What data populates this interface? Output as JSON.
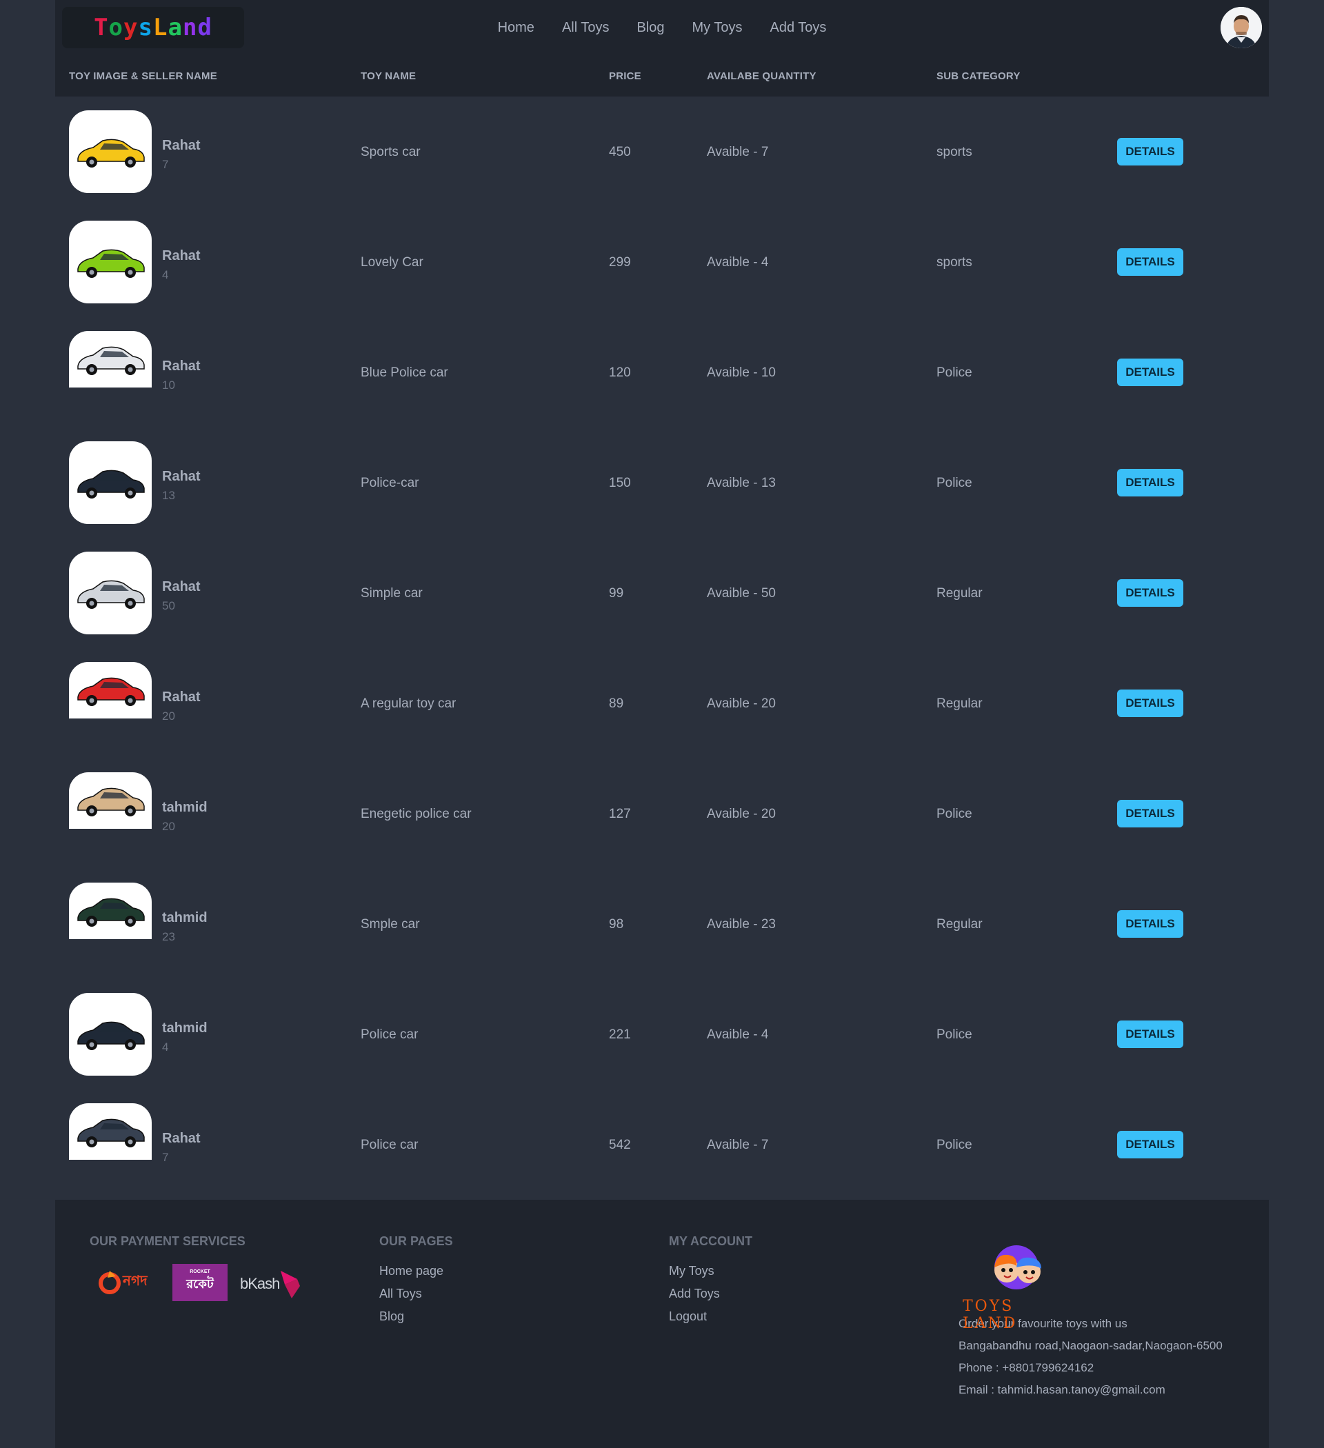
{
  "brand": {
    "letters": [
      {
        "ch": "T",
        "color": "#e11d48"
      },
      {
        "ch": "o",
        "color": "#16a34a"
      },
      {
        "ch": "y",
        "color": "#dc2626"
      },
      {
        "ch": "s",
        "color": "#0ea5e9"
      },
      {
        "ch": "L",
        "color": "#f59e0b"
      },
      {
        "ch": "a",
        "color": "#22c55e"
      },
      {
        "ch": "n",
        "color": "#9333ea"
      },
      {
        "ch": "d",
        "color": "#7c3aed"
      }
    ]
  },
  "nav": [
    "Home",
    "All Toys",
    "Blog",
    "My Toys",
    "Add Toys"
  ],
  "table": {
    "headers": [
      "Toy Image & Seller Name",
      "Toy Name",
      "Price",
      "Availabe Quantity",
      "Sub Category"
    ],
    "button_label": "DETAILS",
    "rows": [
      {
        "seller": "Rahat",
        "qty": "7",
        "name": "Sports car",
        "price": "450",
        "available": "Avaible - 7",
        "category": "sports",
        "car_color": "#f5c518",
        "short": false
      },
      {
        "seller": "Rahat",
        "qty": "4",
        "name": "Lovely Car",
        "price": "299",
        "available": "Avaible - 4",
        "category": "sports",
        "car_color": "#84cc16",
        "short": false
      },
      {
        "seller": "Rahat",
        "qty": "10",
        "name": "Blue Police car",
        "price": "120",
        "available": "Avaible - 10",
        "category": "Police",
        "car_color": "#e5e7eb",
        "short": true
      },
      {
        "seller": "Rahat",
        "qty": "13",
        "name": "Police-car",
        "price": "150",
        "available": "Avaible - 13",
        "category": "Police",
        "car_color": "#1f2937",
        "short": false
      },
      {
        "seller": "Rahat",
        "qty": "50",
        "name": "Simple car",
        "price": "99",
        "available": "Avaible - 50",
        "category": "Regular",
        "car_color": "#d1d5db",
        "short": false
      },
      {
        "seller": "Rahat",
        "qty": "20",
        "name": "A regular toy car",
        "price": "89",
        "available": "Avaible - 20",
        "category": "Regular",
        "car_color": "#dc2626",
        "short": true
      },
      {
        "seller": "tahmid",
        "qty": "20",
        "name": "Enegetic police car",
        "price": "127",
        "available": "Avaible - 20",
        "category": "Police",
        "car_color": "#d6b48a",
        "short": true
      },
      {
        "seller": "tahmid",
        "qty": "23",
        "name": "Smple car",
        "price": "98",
        "available": "Avaible - 23",
        "category": "Regular",
        "car_color": "#1f3b2f",
        "short": true
      },
      {
        "seller": "tahmid",
        "qty": "4",
        "name": "Police car",
        "price": "221",
        "available": "Avaible - 4",
        "category": "Police",
        "car_color": "#1f2937",
        "short": false
      },
      {
        "seller": "Rahat",
        "qty": "7",
        "name": "Police car",
        "price": "542",
        "available": "Avaible - 7",
        "category": "Police",
        "car_color": "#374151",
        "short": true
      }
    ]
  },
  "footer": {
    "payment_heading": "Our Payment Services",
    "payments": {
      "nagad": "নগদ",
      "rocket": "রকেট",
      "rocket_top": "ROCKET",
      "bkash": "bKash"
    },
    "pages_heading": "Our Pages",
    "pages": [
      "Home page",
      "All Toys",
      "Blog"
    ],
    "account_heading": "My Account",
    "account": [
      "My Toys",
      "Add Toys",
      "Logout"
    ],
    "brand_name": "TOYS LAND",
    "tagline": "Order your favourite toys with us",
    "address": "Bangabandhu road,Naogaon-sadar,Naogaon-6500",
    "phone": "Phone : +8801799624162",
    "email": "Email : tahmid.hasan.tanoy@gmail.com"
  },
  "colors": {
    "accent": "#3abff8",
    "bg": "#2a303c",
    "surface": "#1f242d"
  }
}
